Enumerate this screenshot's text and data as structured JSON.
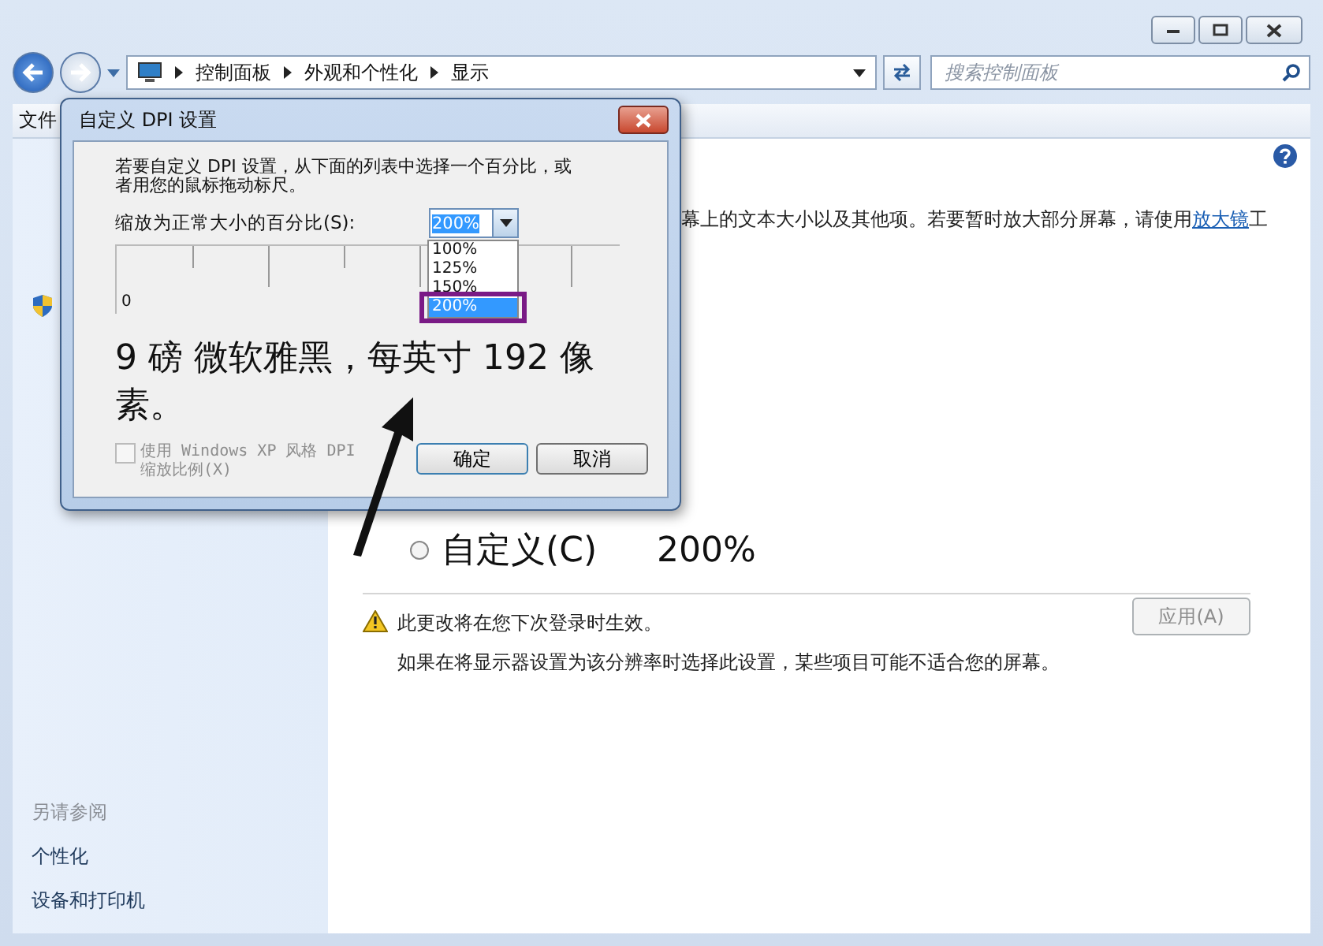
{
  "window": {
    "address": [
      "控制面板",
      "外观和个性化",
      "显示"
    ],
    "search": {
      "placeholder": "搜索控制面板"
    }
  },
  "menu": [
    "文件"
  ],
  "content": {
    "description": "幕上的文本大小以及其他项。若要暂时放大部分屏幕，请使用",
    "link": "放大镜",
    "description_tail": "工",
    "option": {
      "label": "自定义(C)",
      "value": "200%",
      "selected": false
    },
    "notice": {
      "title": "此更改将在您下次登录时生效。",
      "detail": "如果在将显示器设置为该分辨率时选择此设置，某些项目可能不适合您的屏幕。"
    },
    "apply_button": {
      "label": "应用(A)",
      "disabled": true
    }
  },
  "sidebar": {
    "heading": "另请参阅",
    "links": [
      "个性化",
      "设备和打印机"
    ]
  },
  "dialog": {
    "title": "自定义 DPI 设置",
    "instructions": "若要自定义 DPI 设置，从下面的列表中选择一个百分比，或者用您的鼠标拖动标尺。",
    "scale_label": "缩放为正常大小的百分比(S):",
    "combo_value": "200%",
    "options": [
      {
        "label": "100%",
        "selected": false
      },
      {
        "label": "125%",
        "selected": false
      },
      {
        "label": "150%",
        "selected": false
      },
      {
        "label": "200%",
        "selected": true
      }
    ],
    "ruler_label": "0",
    "preview": "9 磅 微软雅黑，每英寸 192 像素。",
    "xp_checkbox": {
      "label": "使用 Windows XP 风格 DPI 缩放比例(X)",
      "checked": false,
      "disabled": true
    },
    "buttons": [
      "确定",
      "取消"
    ]
  }
}
